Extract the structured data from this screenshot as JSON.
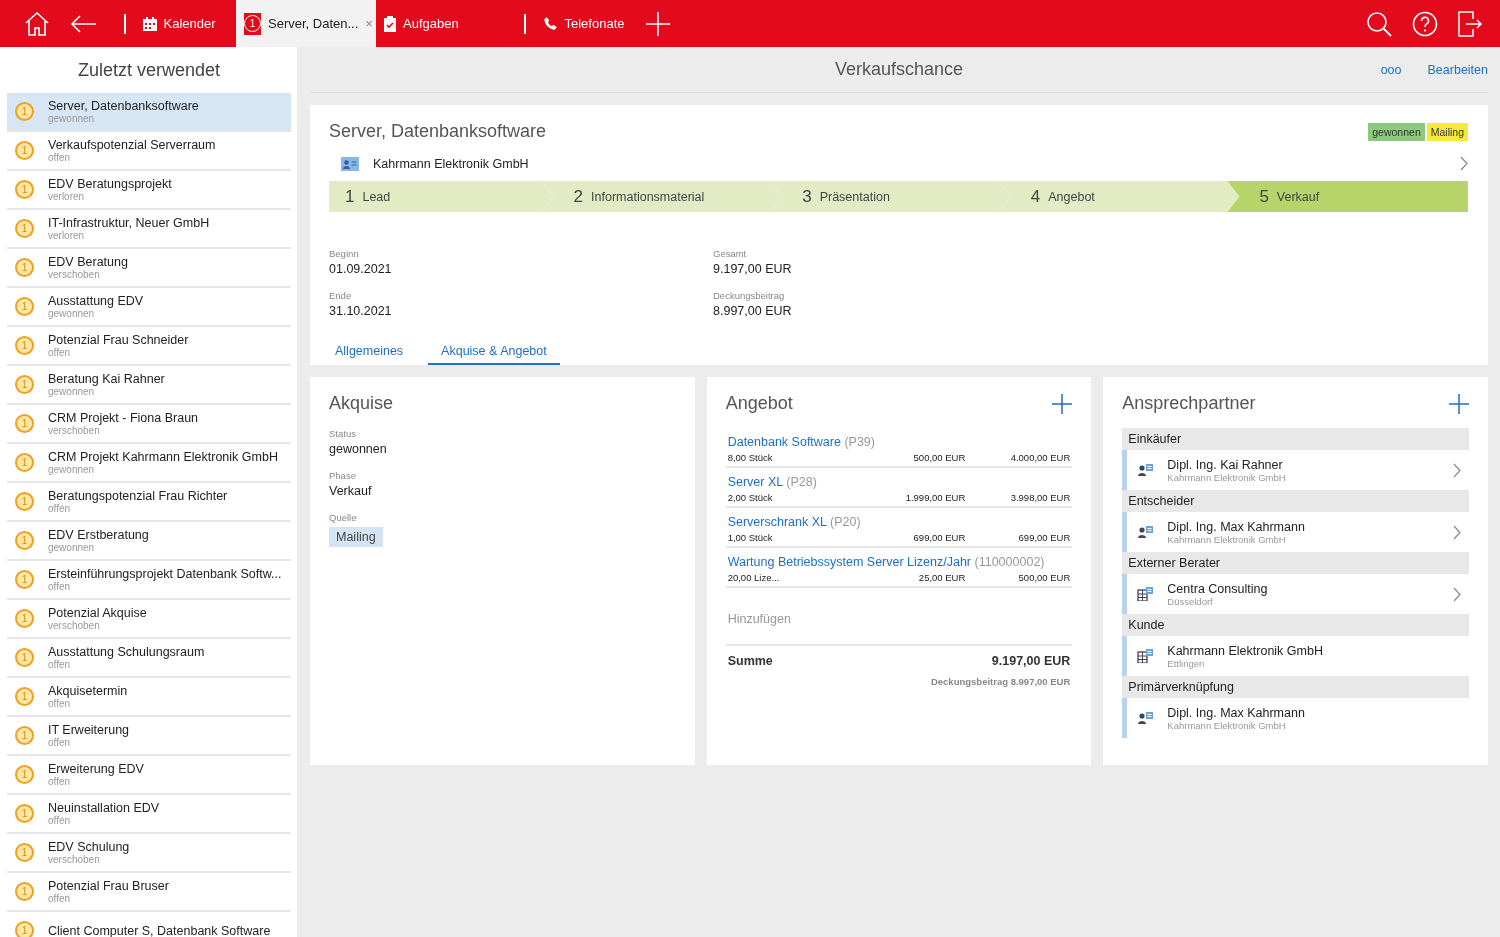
{
  "topbar": {
    "tabs": [
      {
        "kind": "calendar",
        "label": "Kalender",
        "selected": false,
        "divider": true
      },
      {
        "kind": "opportunity",
        "label": "Server, Daten...",
        "selected": true,
        "divider": false,
        "badge": "1",
        "close": "×"
      },
      {
        "kind": "tasks",
        "label": "Aufgaben",
        "selected": false,
        "divider": false
      },
      {
        "kind": "phone",
        "label": "Telefonate",
        "selected": false,
        "divider": true
      }
    ]
  },
  "sidebar": {
    "title": "Zuletzt verwendet",
    "items": [
      {
        "title": "Server, Datenbanksoftware",
        "status": "gewonnen",
        "badge": "1",
        "selected": true
      },
      {
        "title": "Verkaufspotenzial Serverraum",
        "status": "offen",
        "badge": "1",
        "selected": false
      },
      {
        "title": "EDV Beratungsprojekt",
        "status": "verloren",
        "badge": "1",
        "selected": false
      },
      {
        "title": "IT-Infrastruktur, Neuer GmbH",
        "status": "verloren",
        "badge": "1",
        "selected": false
      },
      {
        "title": "EDV Beratung",
        "status": "verschoben",
        "badge": "1",
        "selected": false
      },
      {
        "title": "Ausstattung EDV",
        "status": "gewonnen",
        "badge": "1",
        "selected": false
      },
      {
        "title": "Potenzial Frau Schneider",
        "status": "offen",
        "badge": "1",
        "selected": false
      },
      {
        "title": "Beratung Kai Rahner",
        "status": "gewonnen",
        "badge": "1",
        "selected": false
      },
      {
        "title": "CRM Projekt - Fiona Braun",
        "status": "verschoben",
        "badge": "1",
        "selected": false
      },
      {
        "title": "CRM Projekt Kahrmann Elektronik GmbH",
        "status": "gewonnen",
        "badge": "1",
        "selected": false
      },
      {
        "title": "Beratungspotenzial Frau Richter",
        "status": "offen",
        "badge": "1",
        "selected": false
      },
      {
        "title": "EDV Erstberatung",
        "status": "gewonnen",
        "badge": "1",
        "selected": false
      },
      {
        "title": "Ersteinführungsprojekt Datenbank Softw...",
        "status": "offen",
        "badge": "1",
        "selected": false
      },
      {
        "title": "Potenzial Akquise",
        "status": "verschoben",
        "badge": "1",
        "selected": false
      },
      {
        "title": "Ausstattung Schulungsraum",
        "status": "offen",
        "badge": "1",
        "selected": false
      },
      {
        "title": "Akquisetermin",
        "status": "offen",
        "badge": "1",
        "selected": false
      },
      {
        "title": "IT Erweiterung",
        "status": "offen",
        "badge": "1",
        "selected": false
      },
      {
        "title": "Erweiterung EDV",
        "status": "offen",
        "badge": "1",
        "selected": false
      },
      {
        "title": "Neuinstallation EDV",
        "status": "offen",
        "badge": "1",
        "selected": false
      },
      {
        "title": "EDV Schulung",
        "status": "verschoben",
        "badge": "1",
        "selected": false
      },
      {
        "title": "Potenzial Frau Bruser",
        "status": "offen",
        "badge": "1",
        "selected": false
      },
      {
        "title": "Client Computer S, Datenbank Software",
        "badge": "1",
        "selected": false
      }
    ]
  },
  "header": {
    "title": "Verkaufschance",
    "more": "ooo",
    "edit": "Bearbeiten"
  },
  "opportunity": {
    "title": "Server, Datenbanksoftware",
    "tags": [
      {
        "label": "gewonnen",
        "color": "#8cc97c"
      },
      {
        "label": "Mailing",
        "color": "#f7e93c"
      }
    ],
    "company": "Kahrmann Elektronik GmbH",
    "stages": [
      {
        "number": "1",
        "label": "Lead",
        "selected": false
      },
      {
        "number": "2",
        "label": "Informationsmaterial",
        "selected": false
      },
      {
        "number": "3",
        "label": "Präsentation",
        "selected": false
      },
      {
        "number": "4",
        "label": "Angebot",
        "selected": false
      },
      {
        "number": "5",
        "label": "Verkauf",
        "selected": true
      }
    ],
    "fields": [
      {
        "label": "Beginn",
        "value": "01.09.2021"
      },
      {
        "label": "Gesamt",
        "value": "9.197,00 EUR"
      },
      {
        "label": "Ende",
        "value": "31.10.2021"
      },
      {
        "label": "Deckungsbeitrag",
        "value": "8.997,00 EUR"
      }
    ],
    "tabs": [
      {
        "label": "Allgemeines",
        "selected": false
      },
      {
        "label": "Akquise & Angebot",
        "selected": true
      }
    ]
  },
  "akquise": {
    "title": "Akquise",
    "fields": [
      {
        "label": "Status",
        "value": "gewonnen",
        "kind": "text"
      },
      {
        "label": "Phase",
        "value": "Verkauf",
        "kind": "text"
      },
      {
        "label": "Quelle",
        "value": "Mailing",
        "kind": "chip"
      }
    ]
  },
  "angebot": {
    "title": "Angebot",
    "items": [
      {
        "name": "Datenbank Software",
        "code": "(P39)",
        "quantity": "8,00 Stück",
        "price": "500,00 EUR",
        "total": "4.000,00 EUR"
      },
      {
        "name": "Server XL",
        "code": "(P28)",
        "quantity": "2,00 Stück",
        "price": "1.999,00 EUR",
        "total": "3.998,00 EUR"
      },
      {
        "name": "Serverschrank XL",
        "code": "(P20)",
        "quantity": "1,00 Stück",
        "price": "699,00 EUR",
        "total": "699,00 EUR"
      },
      {
        "name": "Wartung Betriebssystem Server Lizenz/Jahr",
        "code": "(110000002)",
        "quantity": "20,00 Lize...",
        "price": "25,00 EUR",
        "total": "500,00 EUR"
      }
    ],
    "add": "Hinzufügen",
    "sum_label": "Summe",
    "sum": "9.197,00 EUR",
    "margin": "Deckungsbeitrag 8.997,00 EUR"
  },
  "ansprechpartner": {
    "title": "Ansprechpartner",
    "groups": [
      {
        "heading": "Einkäufer",
        "name": "Dipl. Ing. Kai Rahner",
        "sub": "Kahrmann Elektronik GmbH",
        "kind": "person",
        "chevron": true
      },
      {
        "heading": "Entscheider",
        "name": "Dipl. Ing. Max Kahrmann",
        "sub": "Kahrmann Elektronik GmbH",
        "kind": "person",
        "chevron": true
      },
      {
        "heading": "Externer Berater",
        "name": "Centra Consulting",
        "sub": "Düsseldorf",
        "kind": "company",
        "chevron": true
      },
      {
        "heading": "Kunde",
        "name": "Kahrmann Elektronik GmbH",
        "sub": "Ettlingen",
        "kind": "company",
        "chevron": false
      },
      {
        "heading": "Primärverknüpfung",
        "name": "Dipl. Ing. Max Kahrmann",
        "sub": "Kahrmann Elektronik GmbH",
        "kind": "person",
        "chevron": false
      }
    ]
  }
}
